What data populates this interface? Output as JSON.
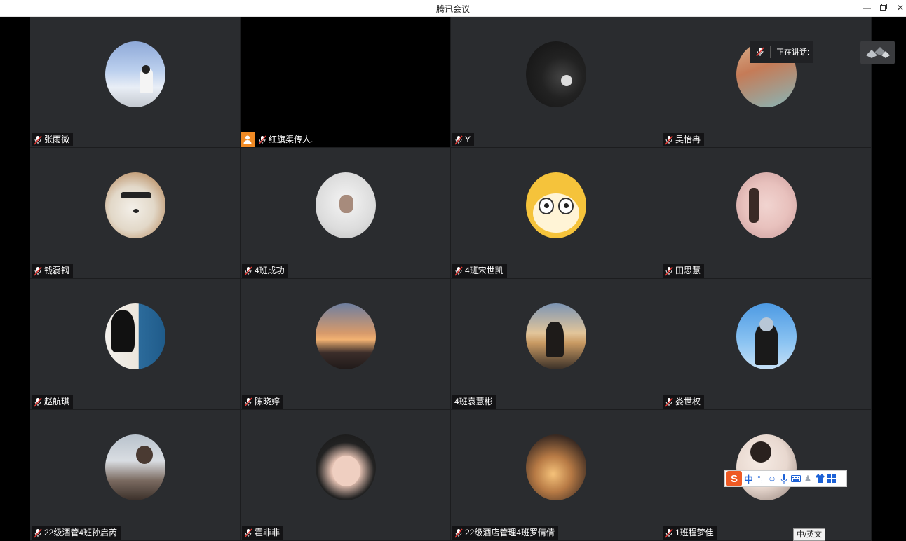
{
  "window": {
    "title": "腾讯会议"
  },
  "speaking": {
    "label": "正在讲话:"
  },
  "participants": [
    {
      "name": "张雨微",
      "avatar": "girl-sky-icon"
    },
    {
      "name": "红旗渠传人.",
      "avatar": "video-off",
      "host": true
    },
    {
      "name": "Y",
      "avatar": "girl-dark-icon"
    },
    {
      "name": "吴怡冉",
      "avatar": "anime-girl-icon"
    },
    {
      "name": "钱磊钢",
      "avatar": "dog-sunglasses-icon"
    },
    {
      "name": "4班成功",
      "avatar": "white-hood-icon"
    },
    {
      "name": "4班宋世凯",
      "avatar": "cartoon-dog-icon"
    },
    {
      "name": "田思慧",
      "avatar": "girl-pink-icon"
    },
    {
      "name": "赵航琪",
      "avatar": "girl-white-icon"
    },
    {
      "name": "陈晓婷",
      "avatar": "sunset-icon"
    },
    {
      "name": "4班袁慧彬",
      "avatar": "sunset-man-icon",
      "nomic": true
    },
    {
      "name": "娄世权",
      "avatar": "blue-sky-boy-icon"
    },
    {
      "name": "22级酒管4班孙启芮",
      "avatar": "snow-boy-icon"
    },
    {
      "name": "霍非非",
      "avatar": "girl-selfie-icon"
    },
    {
      "name": "22级酒店管理4班罗倩倩",
      "avatar": "girl-hand-icon"
    },
    {
      "name": "1班程梦佳",
      "avatar": "girl-bear-icon"
    }
  ],
  "ime": {
    "logo": "S",
    "mode": "中",
    "tooltip": "中/英文"
  }
}
